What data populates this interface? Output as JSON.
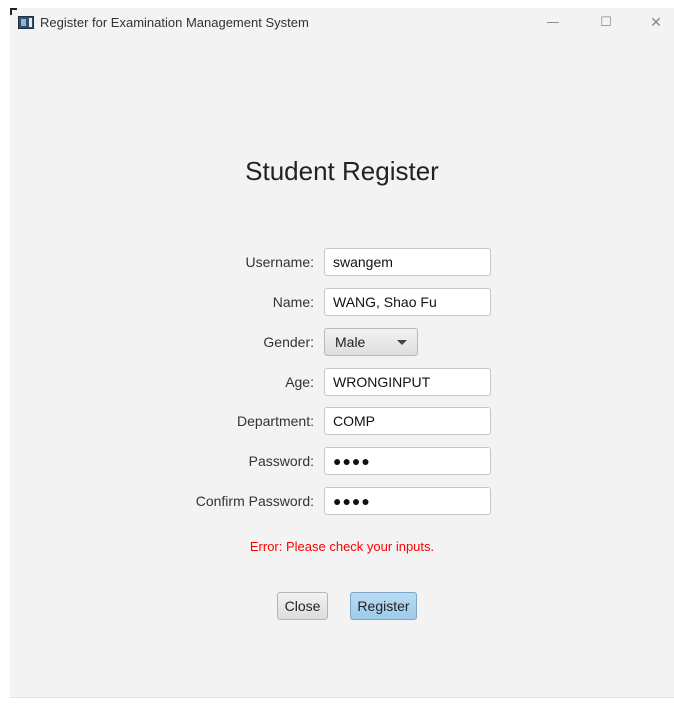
{
  "window": {
    "title": "Register for Examination Management System",
    "controls": {
      "minimize": "—",
      "maximize": "☐",
      "close": "✕"
    }
  },
  "form": {
    "heading": "Student Register",
    "username": {
      "label": "Username:",
      "value": "swangem"
    },
    "name": {
      "label": "Name:",
      "value": "WANG, Shao Fu"
    },
    "gender": {
      "label": "Gender:",
      "selected": "Male"
    },
    "age": {
      "label": "Age:",
      "value": "WRONGINPUT"
    },
    "department": {
      "label": "Department:",
      "value": "COMP"
    },
    "password": {
      "label": "Password:",
      "masked": "●●●●"
    },
    "confirm_password": {
      "label": "Confirm Password:",
      "masked": "●●●●"
    },
    "error": "Error: Please check your inputs.",
    "close_label": "Close",
    "register_label": "Register"
  },
  "colors": {
    "error": "#ff0000",
    "register_button": "#a9d2ee",
    "window_bg": "#f3f3f3"
  }
}
